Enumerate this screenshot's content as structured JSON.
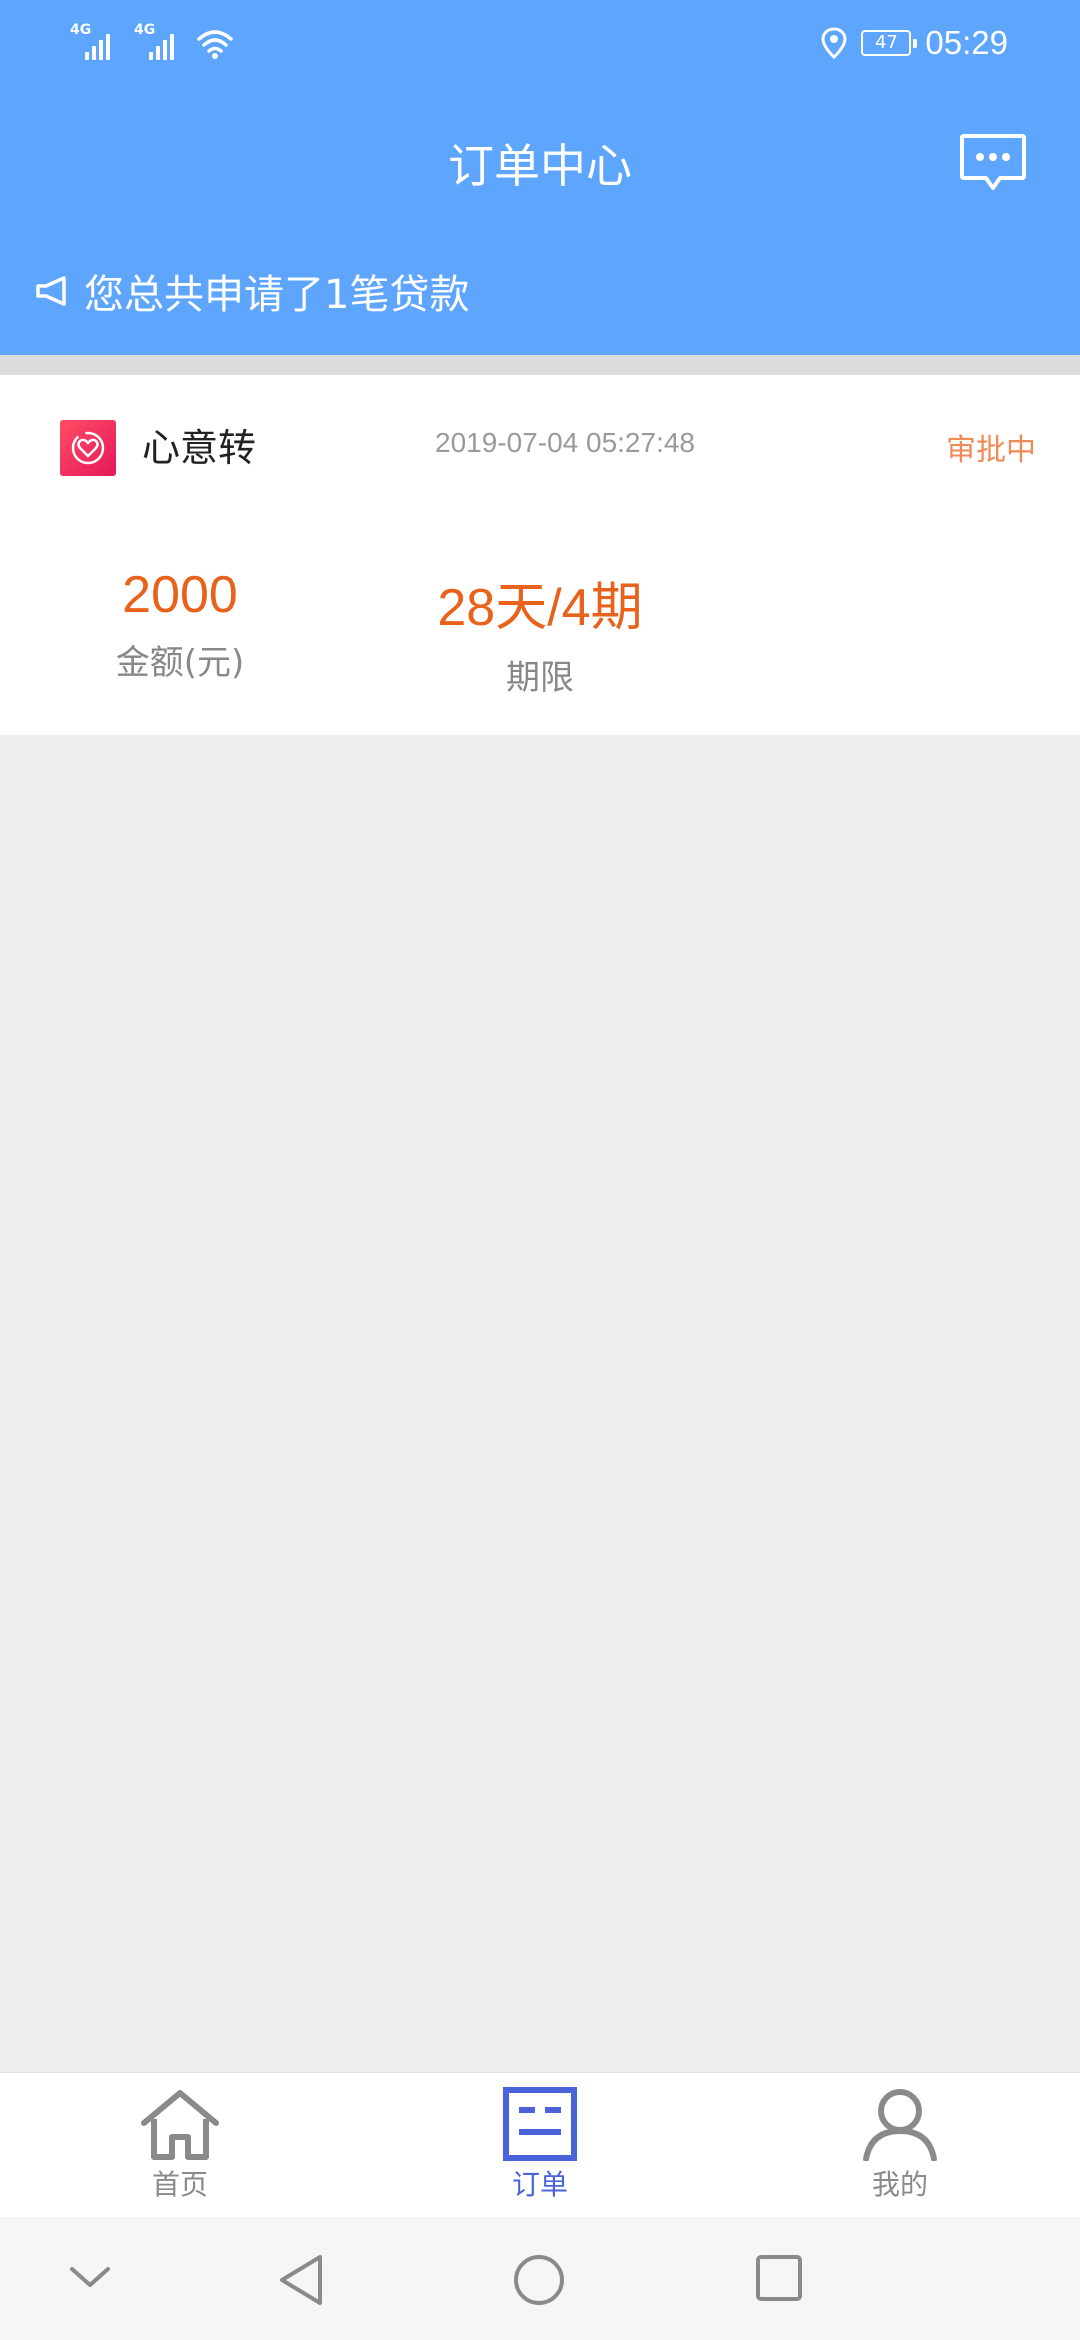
{
  "status_bar": {
    "signal1_label": "4G",
    "signal2_label": "4G",
    "battery": "47",
    "time": "05:29"
  },
  "header": {
    "title": "订单中心",
    "message_icon": "chat-bubble-icon",
    "notice_icon": "megaphone-icon",
    "notice_text": "您总共申请了1笔贷款"
  },
  "order": {
    "logo_icon": "heart-logo-icon",
    "product_name": "心意转",
    "time": "2019-07-04 05:27:48",
    "status": "审批中",
    "amount_value": "2000",
    "amount_label": "金额(元)",
    "term_value": "28天/4期",
    "term_label": "期限"
  },
  "tabs": [
    {
      "label": "首页",
      "icon": "home-icon",
      "active": false
    },
    {
      "label": "订单",
      "icon": "order-icon",
      "active": true
    },
    {
      "label": "我的",
      "icon": "user-icon",
      "active": false
    }
  ],
  "colors": {
    "header_blue": "#5ea5fd",
    "accent_orange": "#e9621b",
    "status_orange": "#f08a56",
    "tab_active": "#4a63d8"
  }
}
